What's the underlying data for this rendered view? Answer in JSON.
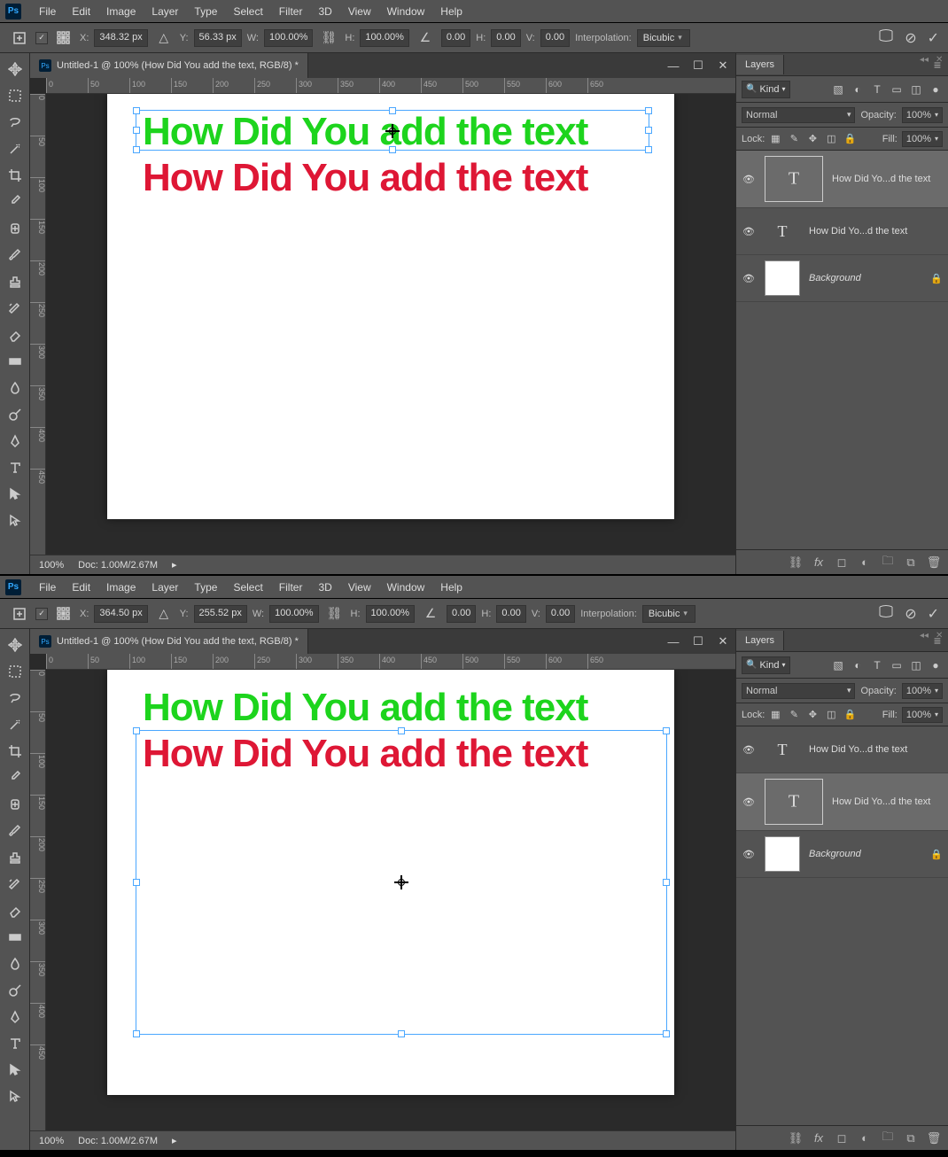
{
  "menu": [
    "File",
    "Edit",
    "Image",
    "Layer",
    "Type",
    "Select",
    "Filter",
    "3D",
    "View",
    "Window",
    "Help"
  ],
  "app1": {
    "opt": {
      "x": "348.32 px",
      "y": "56.33 px",
      "w": "100.00%",
      "h": "100.00%",
      "rot": "0.00",
      "hskew": "0.00",
      "vskew": "0.00",
      "interp_lbl": "Interpolation:",
      "interp": "Bicubic"
    },
    "tab": "Untitled-1 @ 100% (How Did You add the text, RGB/8) *",
    "txt": "How Did You add the text",
    "zoom": "100%",
    "docinfo": "Doc: 1.00M/2.67M",
    "layers_title": "Layers",
    "kind": "Kind",
    "blend": "Normal",
    "opacity_lbl": "Opacity:",
    "opacity": "100%",
    "lock_lbl": "Lock:",
    "fill_lbl": "Fill:",
    "fill": "100%",
    "layers": [
      {
        "name": "How Did Yo...d the text",
        "type": "text",
        "selected": true
      },
      {
        "name": "How Did Yo...d the text",
        "type": "text",
        "selected": false
      },
      {
        "name": "Background",
        "type": "bg",
        "selected": false,
        "locked": true
      }
    ]
  },
  "app2": {
    "opt": {
      "x": "364.50 px",
      "y": "255.52 px",
      "w": "100.00%",
      "h": "100.00%",
      "rot": "0.00",
      "hskew": "0.00",
      "vskew": "0.00",
      "interp_lbl": "Interpolation:",
      "interp": "Bicubic"
    },
    "tab": "Untitled-1 @ 100% (How Did You add the text, RGB/8) *",
    "txt": "How Did You add the text",
    "zoom": "100%",
    "docinfo": "Doc: 1.00M/2.67M",
    "layers_title": "Layers",
    "kind": "Kind",
    "blend": "Normal",
    "opacity_lbl": "Opacity:",
    "opacity": "100%",
    "lock_lbl": "Lock:",
    "fill_lbl": "Fill:",
    "fill": "100%",
    "layers": [
      {
        "name": "How Did Yo...d the text",
        "type": "text",
        "selected": false
      },
      {
        "name": "How Did Yo...d the text",
        "type": "text",
        "selected": true
      },
      {
        "name": "Background",
        "type": "bg",
        "selected": false,
        "locked": true
      }
    ]
  },
  "ruler_ticks": [
    0,
    50,
    100,
    150,
    200,
    250,
    300,
    350,
    400,
    450,
    500,
    550,
    600,
    650
  ],
  "ruler_v": [
    0,
    50,
    100,
    150,
    200,
    250,
    300,
    350,
    400,
    450
  ]
}
